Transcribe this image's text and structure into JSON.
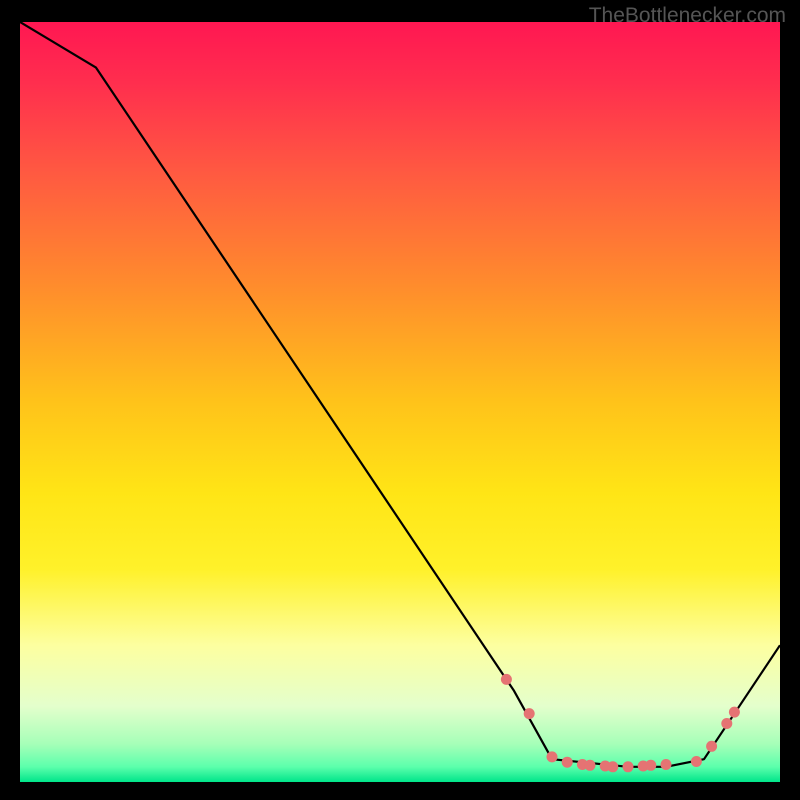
{
  "watermark": "TheBottlenecker.com",
  "chart_data": {
    "type": "line",
    "title": "",
    "xlabel": "",
    "ylabel": "",
    "xlim": [
      0,
      100
    ],
    "ylim": [
      0,
      100
    ],
    "series": [
      {
        "name": "curve",
        "x": [
          0,
          10,
          65,
          70,
          80,
          85,
          90,
          100
        ],
        "y": [
          100,
          94,
          12,
          3,
          2,
          2,
          3,
          18
        ]
      }
    ],
    "markers": {
      "name": "highlight-points",
      "x": [
        64,
        67,
        70,
        72,
        74,
        75,
        77,
        78,
        80,
        82,
        83,
        85,
        89,
        91,
        93,
        94
      ],
      "y": [
        13.5,
        9,
        3.3,
        2.6,
        2.3,
        2.2,
        2.1,
        2.0,
        2.0,
        2.1,
        2.2,
        2.3,
        2.7,
        4.7,
        7.7,
        9.2
      ],
      "color": "#e57373"
    },
    "gradient_stops": [
      {
        "offset": 0.0,
        "color": "#ff1752"
      },
      {
        "offset": 0.08,
        "color": "#ff2e4e"
      },
      {
        "offset": 0.2,
        "color": "#ff5a41"
      },
      {
        "offset": 0.35,
        "color": "#ff8d2c"
      },
      {
        "offset": 0.5,
        "color": "#ffc31a"
      },
      {
        "offset": 0.62,
        "color": "#ffe516"
      },
      {
        "offset": 0.72,
        "color": "#fff12a"
      },
      {
        "offset": 0.82,
        "color": "#fdffa0"
      },
      {
        "offset": 0.9,
        "color": "#e4ffcc"
      },
      {
        "offset": 0.95,
        "color": "#a6ffb8"
      },
      {
        "offset": 0.98,
        "color": "#5cffac"
      },
      {
        "offset": 1.0,
        "color": "#00e58a"
      }
    ]
  }
}
